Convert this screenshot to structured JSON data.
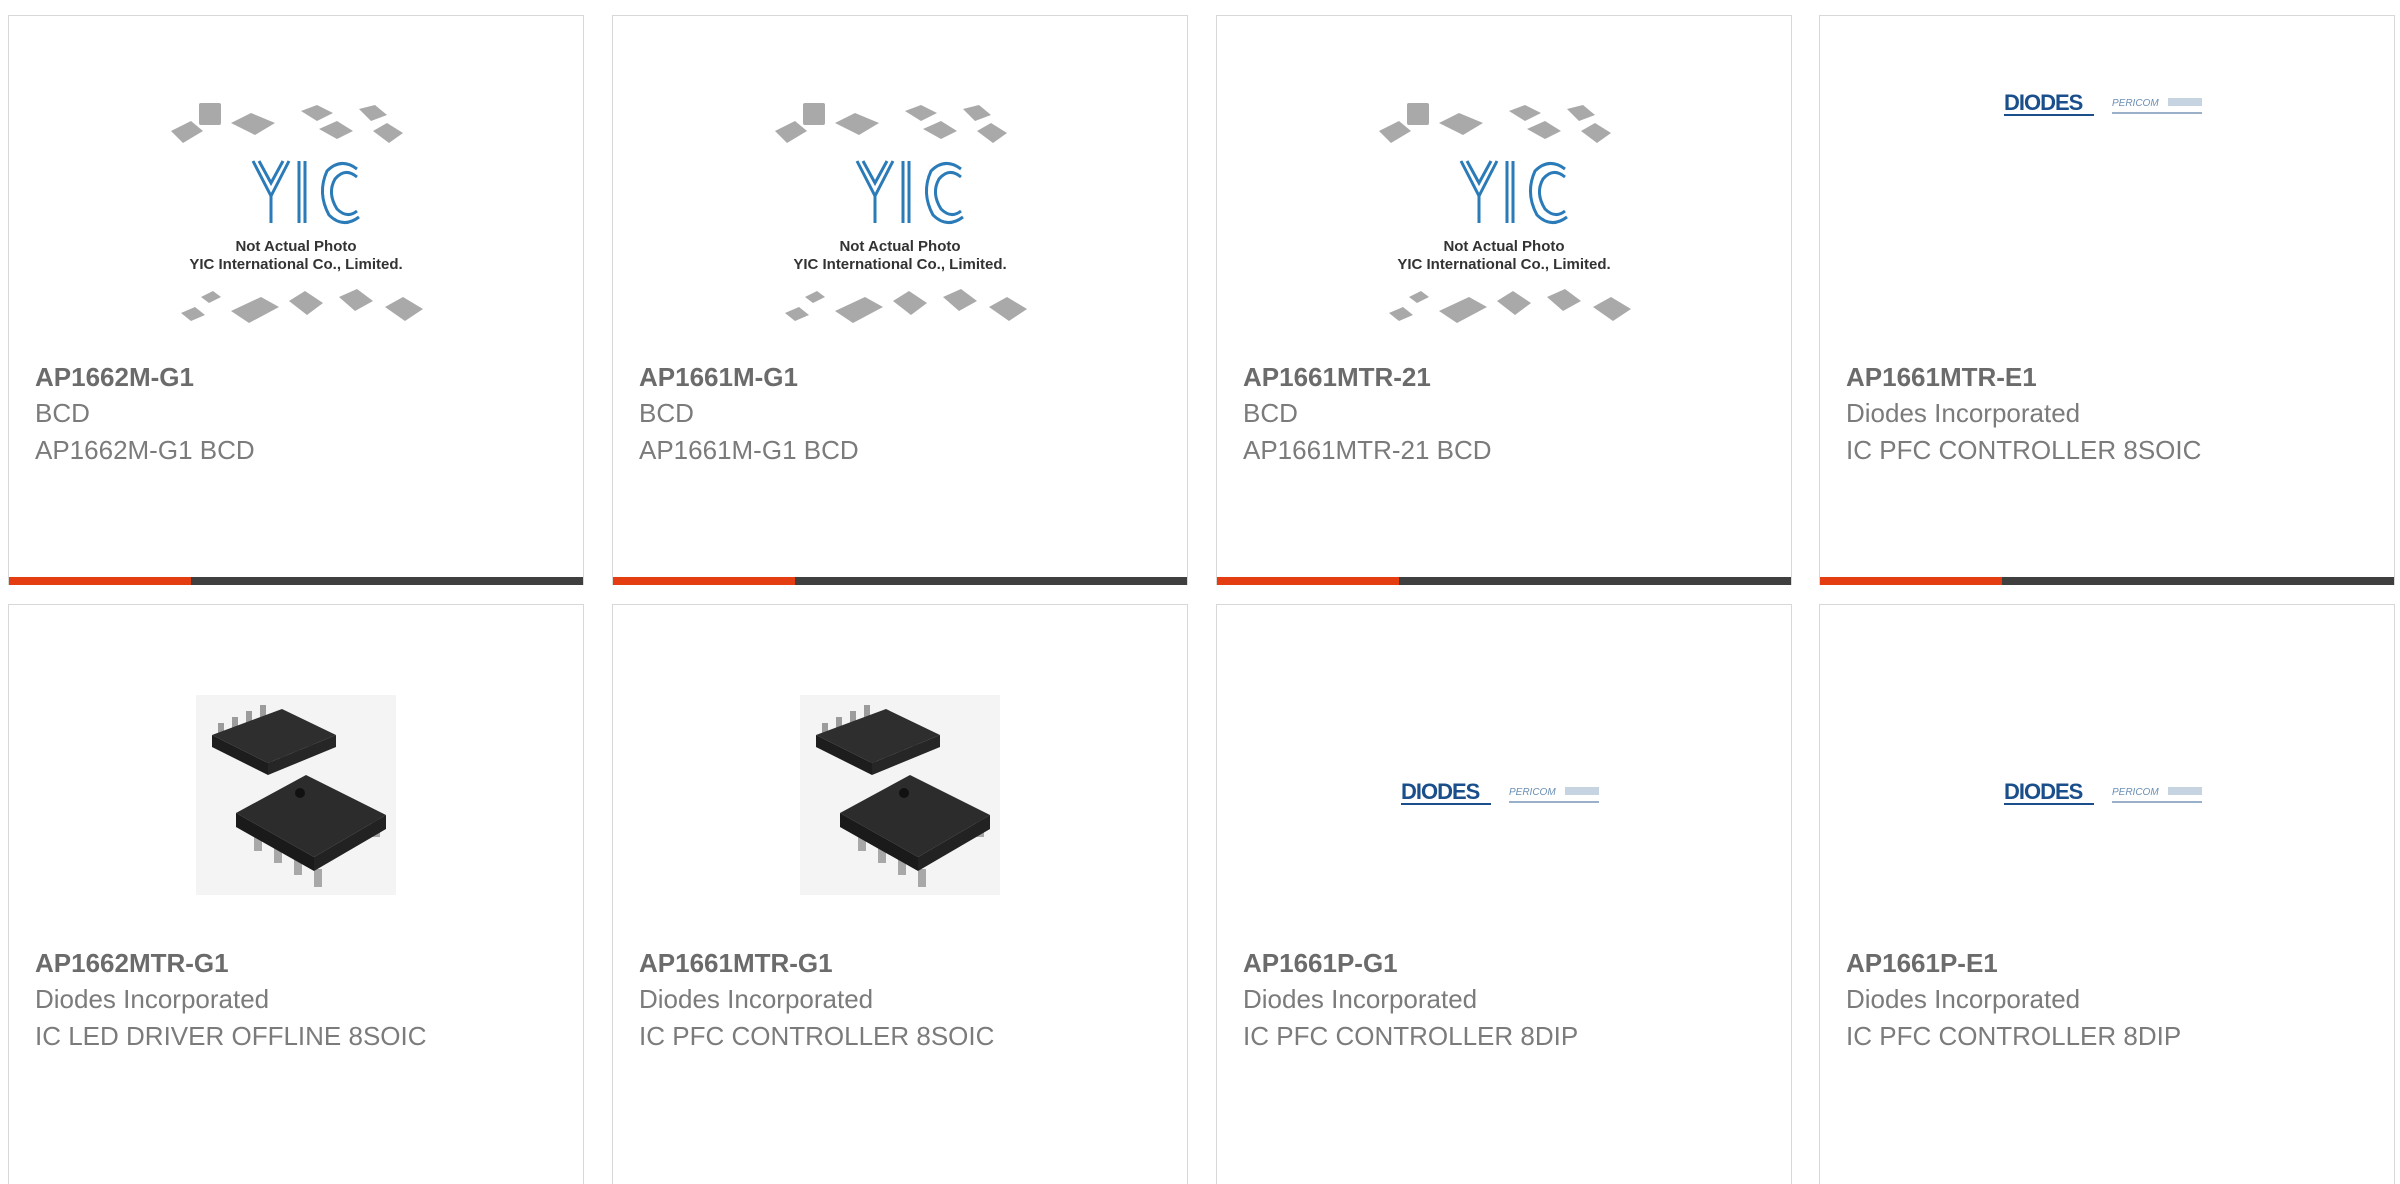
{
  "colors": {
    "accent": "#e43d12",
    "bar": "#3f3f3f",
    "diodes_blue": "#1a4f8c",
    "yic_blue": "#2a7bb8"
  },
  "cards": [
    {
      "part": "AP1662M-G1",
      "mfr": "BCD",
      "desc": "AP1662M-G1 BCD",
      "image": "yic-placeholder",
      "img_line1": "Not Actual Photo",
      "img_line2": "YIC International Co., Limited.",
      "img_logo": "YIC"
    },
    {
      "part": "AP1661M-G1",
      "mfr": "BCD",
      "desc": "AP1661M-G1 BCD",
      "image": "yic-placeholder",
      "img_line1": "Not Actual Photo",
      "img_line2": "YIC International Co., Limited.",
      "img_logo": "YIC"
    },
    {
      "part": "AP1661MTR-21",
      "mfr": "BCD",
      "desc": "AP1661MTR-21 BCD",
      "image": "yic-placeholder",
      "img_line1": "Not Actual Photo",
      "img_line2": "YIC International Co., Limited.",
      "img_logo": "YIC"
    },
    {
      "part": "AP1661MTR-E1",
      "mfr": "Diodes Incorporated",
      "desc": "IC PFC CONTROLLER 8SOIC",
      "image": "diodes-logo",
      "img_logo": "DIODES",
      "img_logo2": "PERICOM"
    },
    {
      "part": "AP1662MTR-G1",
      "mfr": "Diodes Incorporated",
      "desc": "IC LED DRIVER OFFLINE 8SOIC",
      "image": "soic-chip"
    },
    {
      "part": "AP1661MTR-G1",
      "mfr": "Diodes Incorporated",
      "desc": "IC PFC CONTROLLER 8SOIC",
      "image": "soic-chip"
    },
    {
      "part": "AP1661P-G1",
      "mfr": "Diodes Incorporated",
      "desc": "IC PFC CONTROLLER 8DIP",
      "image": "diodes-logo",
      "img_logo": "DIODES",
      "img_logo2": "PERICOM"
    },
    {
      "part": "AP1661P-E1",
      "mfr": "Diodes Incorporated",
      "desc": "IC PFC CONTROLLER 8DIP",
      "image": "diodes-logo",
      "img_logo": "DIODES",
      "img_logo2": "PERICOM"
    }
  ]
}
